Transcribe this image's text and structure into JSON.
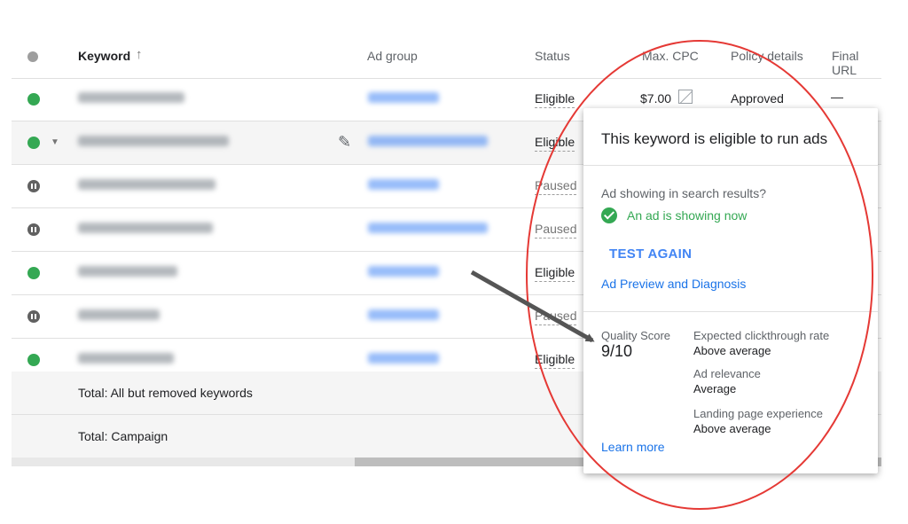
{
  "columns": {
    "keyword": "Keyword",
    "ad_group": "Ad group",
    "status": "Status",
    "max_cpc": "Max. CPC",
    "policy": "Policy details",
    "final_url": "Final URL"
  },
  "rows": [
    {
      "status": "Eligible",
      "max_cpc": "$7.00",
      "policy": "Approved",
      "final_url": "—"
    },
    {
      "status": "Eligible"
    },
    {
      "status": "Paused"
    },
    {
      "status": "Paused"
    },
    {
      "status": "Eligible"
    },
    {
      "status": "Paused"
    },
    {
      "status": "Eligible"
    }
  ],
  "totals": {
    "all_but_removed": "Total: All but removed keywords",
    "campaign": "Total: Campaign"
  },
  "popup": {
    "title": "This keyword is eligible to run ads",
    "search_question": "Ad showing in search results?",
    "showing_now": "An ad is showing now",
    "test_again": "TEST AGAIN",
    "ad_preview": "Ad Preview and Diagnosis",
    "quality_score_label": "Quality Score",
    "quality_score": "9/10",
    "metrics": [
      {
        "label": "Expected clickthrough rate",
        "value": "Above average"
      },
      {
        "label": "Ad relevance",
        "value": "Average"
      },
      {
        "label": "Landing page experience",
        "value": "Above average"
      }
    ],
    "learn_more": "Learn more"
  },
  "colors": {
    "eligible_dot": "#34a853",
    "paused_dot": "#616161",
    "link": "#1a73e8",
    "annotation_circle": "#e53935",
    "annotation_arrow": "#555555"
  }
}
